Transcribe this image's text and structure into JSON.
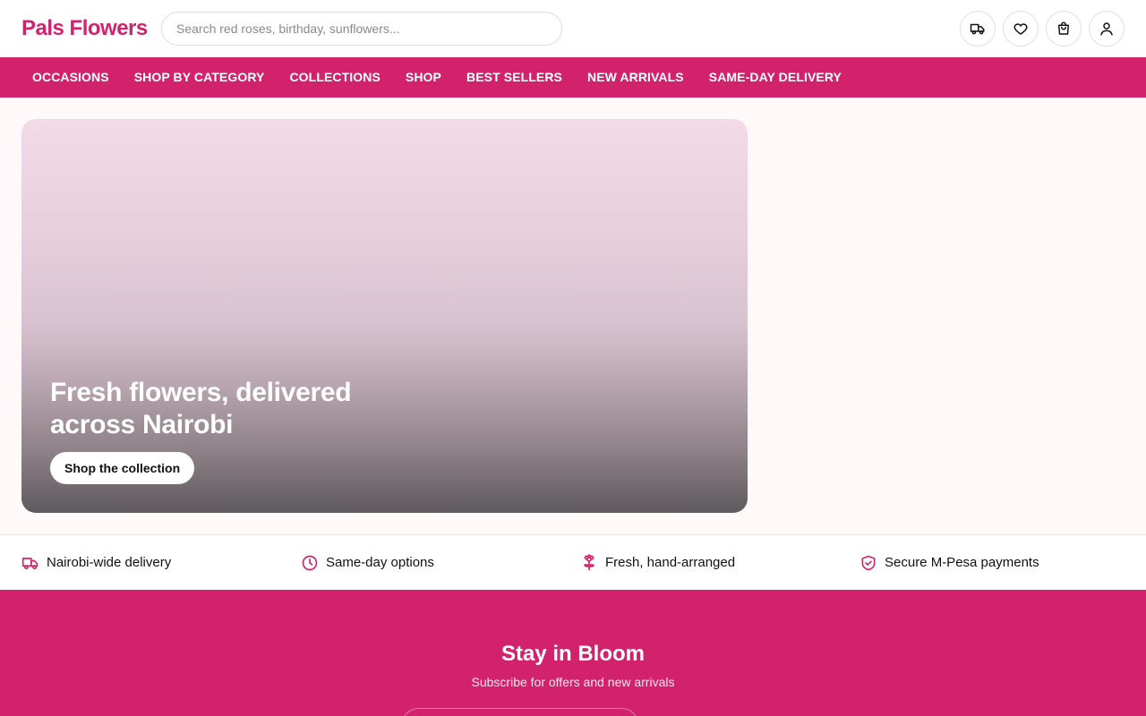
{
  "header": {
    "logo": "Pals Flowers",
    "search_placeholder": "Search red roses, birthday, sunflowers...",
    "icons": [
      "truck-icon",
      "heart-icon",
      "bag-icon",
      "user-icon"
    ]
  },
  "nav": {
    "items": [
      "OCCASIONS",
      "SHOP BY CATEGORY",
      "COLLECTIONS",
      "SHOP",
      "BEST SELLERS",
      "NEW ARRIVALS",
      "SAME-DAY DELIVERY"
    ]
  },
  "hero": {
    "title": "Fresh flowers, delivered across Nairobi",
    "cta": "Shop the collection"
  },
  "features": [
    {
      "label": "Nairobi-wide delivery",
      "icon": "truck-icon"
    },
    {
      "label": "Same-day options",
      "icon": "clock-icon"
    },
    {
      "label": "Fresh, hand-arranged",
      "icon": "flower-icon"
    },
    {
      "label": "Secure M-Pesa payments",
      "icon": "shield-check-icon"
    }
  ],
  "newsletter": {
    "title": "Stay in Bloom",
    "subtitle": "Subscribe for offers and new arrivals"
  },
  "colors": {
    "brand": "#d3226c",
    "background": "#fff9fa"
  }
}
